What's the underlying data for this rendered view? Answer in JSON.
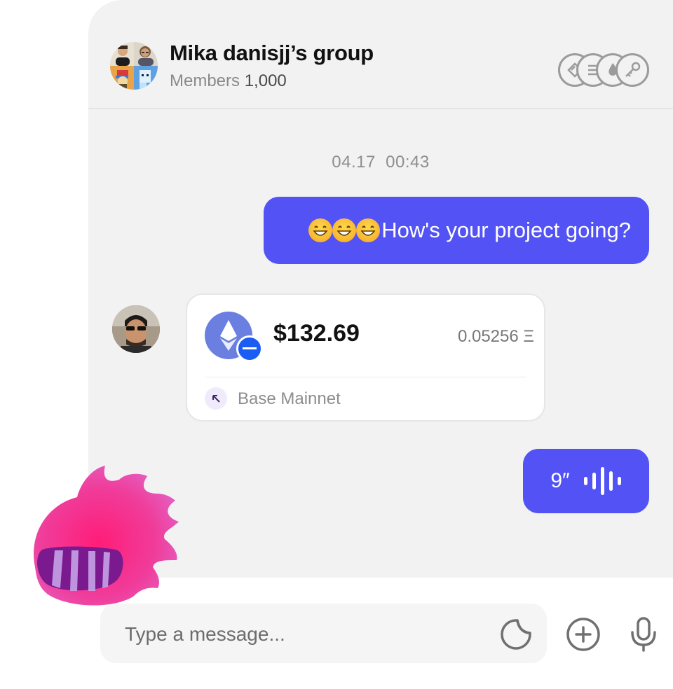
{
  "header": {
    "title": "Mika danisjj’s group",
    "members_label": "Members",
    "members_count": "1,000",
    "badges": [
      "gem-icon",
      "coin-icon",
      "flame-icon",
      "key-icon"
    ]
  },
  "chat": {
    "timestamp": "04.17  00:43",
    "messages": [
      {
        "direction": "outgoing",
        "emojis": [
          "grinning-face",
          "grinning-face",
          "grinning-face"
        ],
        "text": "How's your project going?"
      },
      {
        "direction": "incoming",
        "type": "transaction",
        "amount": "$132.69",
        "crypto_amount": "0.05256 Ξ",
        "network": "Base Mainnet"
      },
      {
        "direction": "outgoing",
        "type": "voice",
        "duration": "9″"
      }
    ]
  },
  "composer": {
    "placeholder": "Type a message...",
    "icons": [
      "sticker-icon",
      "add-icon",
      "microphone-icon"
    ]
  },
  "colors": {
    "accent": "#5252f5",
    "panel_bg": "#f2f2f2",
    "eth": "#6a7fe0",
    "blob": "#f0267e"
  }
}
